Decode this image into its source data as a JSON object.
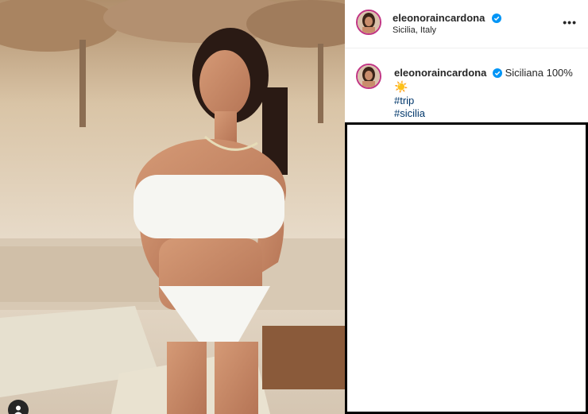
{
  "post": {
    "image_description_icon": "photo",
    "user_tag_icon": "person-icon"
  },
  "header": {
    "username": "eleonoraincardona",
    "location": "Sicilia, Italy",
    "more_label": "•••"
  },
  "caption": {
    "username": "eleonoraincardona",
    "text": "Siciliana 100%",
    "emoji": "☀️",
    "hashtags": [
      "#trip",
      "#sicilia"
    ]
  },
  "colors": {
    "hashtag": "#00376b",
    "verified": "#0095f6",
    "avatar_ring": "#c13584"
  }
}
